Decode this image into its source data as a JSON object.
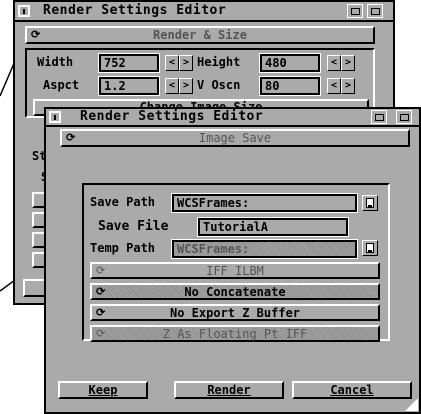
{
  "back_window": {
    "title": "Render Settings Editor",
    "header": "Render & Size",
    "width_label": "Width",
    "width_value": "752",
    "height_label": "Height",
    "height_value": "480",
    "aspect_label": "Aspct",
    "aspect_value": "1.2",
    "vscan_label": "V Oscn",
    "vscan_value": "80",
    "change_size_button": "Change Image Size",
    "cut_label_1": "St",
    "cut_label_2": "S"
  },
  "front_window": {
    "title": "Render Settings Editor",
    "header": "Image Save",
    "save_path_label": "Save Path",
    "save_path_value": "WCSFrames:",
    "save_file_label": "Save File",
    "save_file_value": "TutorialA",
    "temp_path_label": "Temp Path",
    "temp_path_value": "WCSFrames:",
    "format_cycle": "IFF ILBM",
    "concat_cycle": "No Concatenate",
    "zbuffer_cycle": "No Export Z Buffer",
    "zformat_cycle": "Z As Floating Pt IFF",
    "keep_button": "Keep",
    "render_button": "Render",
    "cancel_button": "Cancel"
  }
}
